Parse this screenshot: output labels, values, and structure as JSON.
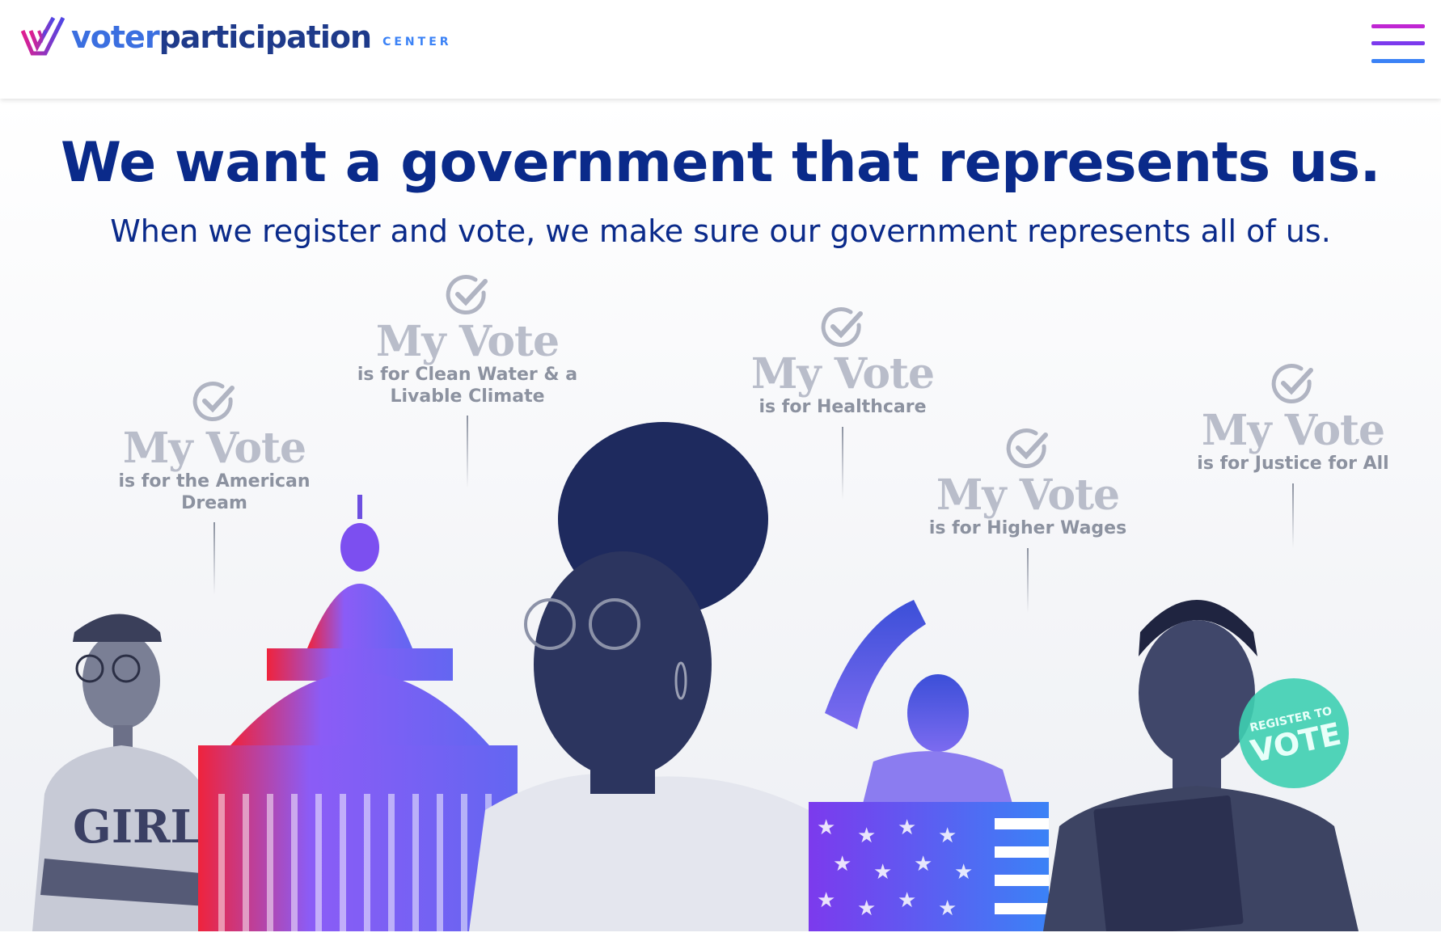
{
  "header": {
    "logo_part1": "voter",
    "logo_part2": "participation",
    "logo_sub": "CENTER",
    "brand_colors": {
      "blue": "#3b6fe0",
      "navy": "#1e3a8a",
      "magenta": "#c026d3",
      "purple": "#7c3aed"
    }
  },
  "hero": {
    "headline": "We want a government that represents us.",
    "subhead": "When we register and vote, we make sure our government represents all of us.",
    "headline_color": "#0a2a8a"
  },
  "votes": [
    {
      "title": "My Vote",
      "caption": "is for the American Dream"
    },
    {
      "title": "My Vote",
      "caption": "is for Clean Water & a Livable Climate"
    },
    {
      "title": "My Vote",
      "caption": "is for Healthcare"
    },
    {
      "title": "My Vote",
      "caption": "is for Higher Wages"
    },
    {
      "title": "My Vote",
      "caption": "is for Justice for All"
    }
  ],
  "photos": {
    "woman_shirt_text": "GIRLS",
    "button_text_top": "REGISTER TO",
    "button_text_main": "VOTE"
  }
}
